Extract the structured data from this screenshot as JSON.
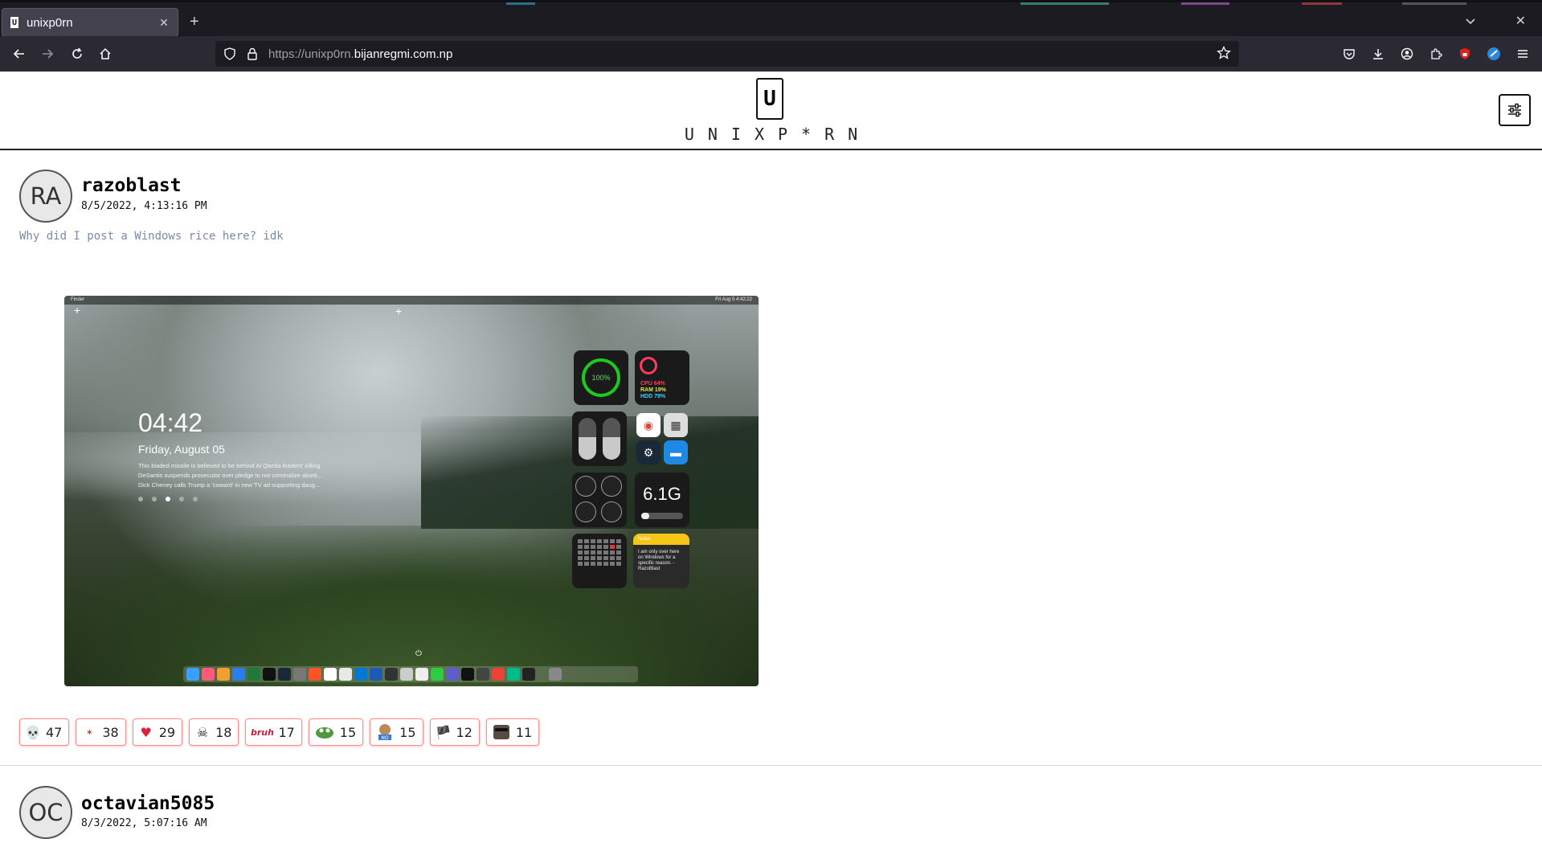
{
  "browser": {
    "tab_title": "unixp0rn",
    "tab_favicon": "U",
    "new_tab": "+",
    "url_prefix": "https://unixp0rn.",
    "url_domain": "bijanregmi.com.np"
  },
  "site": {
    "logo_letter": "U",
    "logo_text": "UNIXP*RN"
  },
  "posts": [
    {
      "avatar": "RA",
      "username": "razoblast",
      "timestamp": "8/5/2022, 4:13:16 PM",
      "caption": "Why did I post a Windows rice here? idk",
      "screenshot": {
        "menubar_left": "Finder",
        "menubar_right": "Fri Aug 5  4:42:22",
        "clock": "04:42",
        "date": "Friday, August 05",
        "news": [
          "This bladed missile is believed to be behind Al Qaeda leaders' killing",
          "DeSantis suspends prosecutor over pledge to not criminalize aborti...",
          "Dick Cheney calls Trump a 'coward' in new TV ad supporting daug..."
        ],
        "battery": "100%",
        "cpu": "CPU 64%",
        "ram": "RAM 19%",
        "hdd": "HDD 79%",
        "memory": "6.1G",
        "notes_title": "Notes",
        "notes_body": "I am only over here on Windows for a specific reason. - RazoBlast"
      },
      "reactions": [
        {
          "icon": "skull-icon",
          "count": "47"
        },
        {
          "icon": "bonk-icon",
          "count": "38"
        },
        {
          "icon": "heart-icon",
          "count": "29"
        },
        {
          "icon": "skull-crossbones-icon",
          "count": "18"
        },
        {
          "icon": "bruh-icon",
          "count": "17"
        },
        {
          "icon": "pepe-icon",
          "count": "15"
        },
        {
          "icon": "dog-no-icon",
          "count": "15"
        },
        {
          "icon": "pirate-flag-icon",
          "count": "12"
        },
        {
          "icon": "cool-face-icon",
          "count": "11"
        }
      ]
    },
    {
      "avatar": "OC",
      "username": "octavian5085",
      "timestamp": "8/3/2022, 5:07:16 AM"
    }
  ],
  "colors": {
    "reaction_border": "#ff8a8a",
    "caption": "#7c8aa5",
    "chrome_bg": "#2b2a33"
  }
}
